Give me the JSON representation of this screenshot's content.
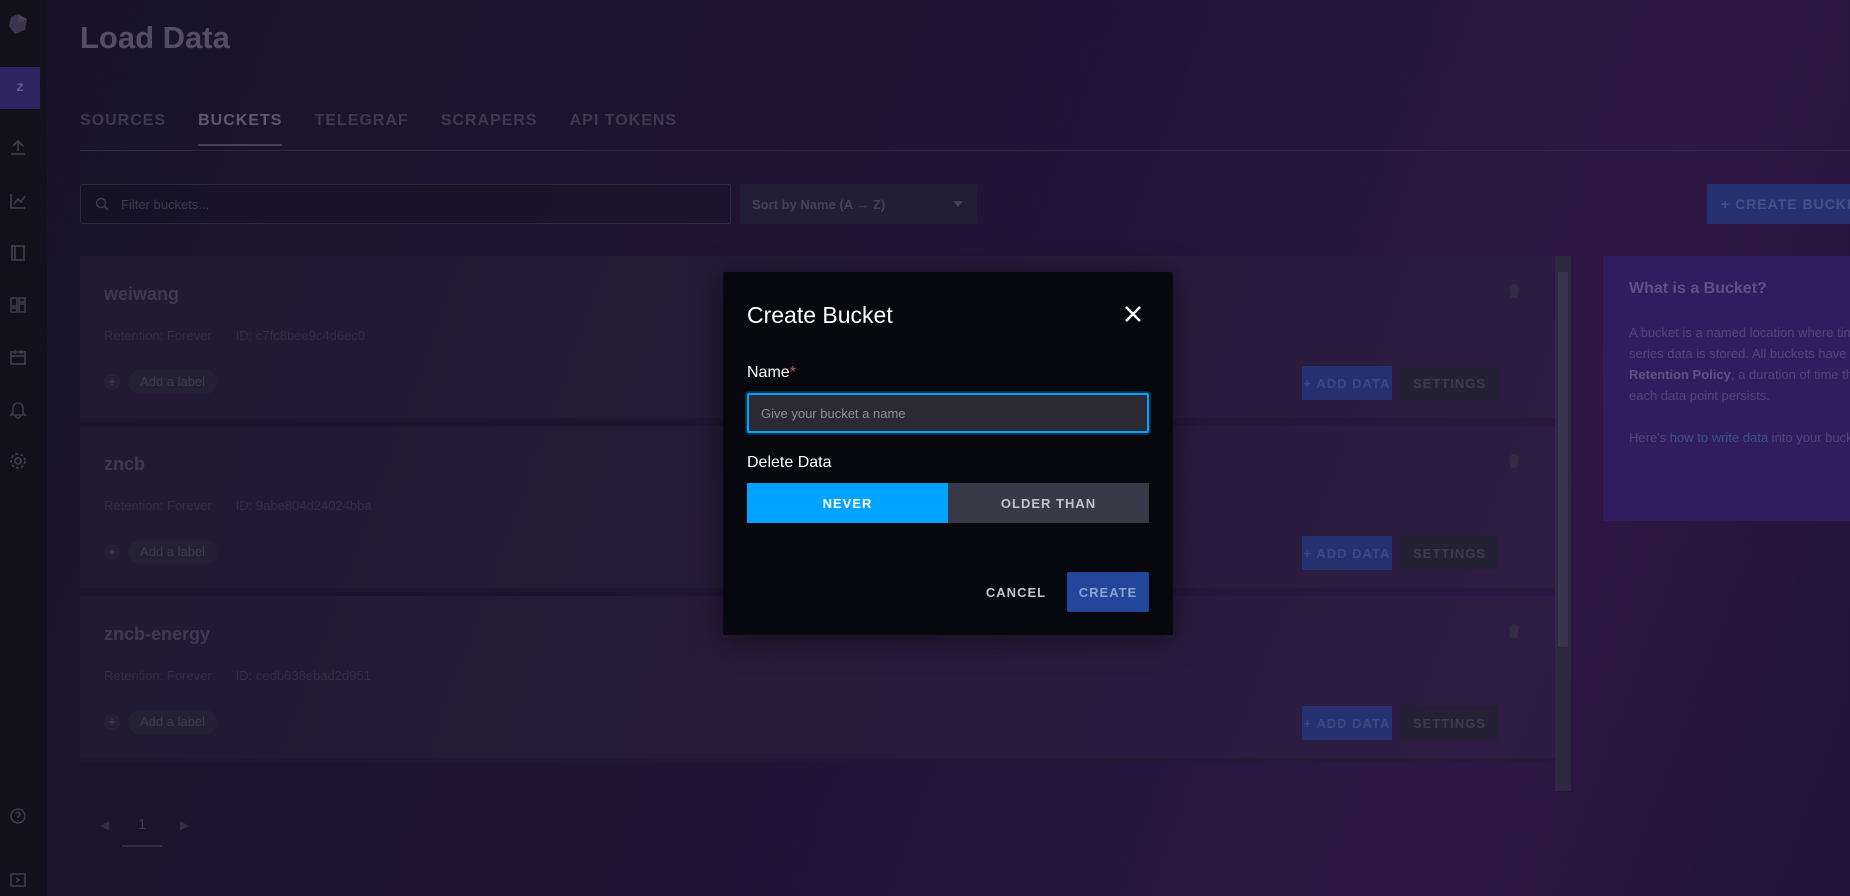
{
  "sidebar": {
    "org_initial": "Z",
    "icons": [
      "upload-icon",
      "graph-icon",
      "notebook-icon",
      "dashboards-icon",
      "calendar-icon",
      "bell-icon",
      "gear-icon",
      "help-icon",
      "expand-icon"
    ]
  },
  "page": {
    "title": "Load Data"
  },
  "tabs": [
    {
      "label": "SOURCES"
    },
    {
      "label": "BUCKETS"
    },
    {
      "label": "TELEGRAF"
    },
    {
      "label": "SCRAPERS"
    },
    {
      "label": "API TOKENS"
    }
  ],
  "toolbar": {
    "filter_placeholder": "Filter buckets...",
    "sort_label": "Sort by Name (A → Z)",
    "create_label": "+  CREATE BUCKET"
  },
  "buckets": [
    {
      "name": "weiwang",
      "retention": "Retention: Forever",
      "id": "ID: c7fc8bee9c4d6ec0",
      "add_label": "Add a label",
      "add_data": "+  ADD DATA",
      "settings": "SETTINGS"
    },
    {
      "name": "zncb",
      "retention": "Retention: Forever",
      "id": "ID: 9abe804d24024bba",
      "add_label": "Add a label",
      "add_data": "+  ADD DATA",
      "settings": "SETTINGS"
    },
    {
      "name": "zncb-energy",
      "retention": "Retention: Forever",
      "id": "ID: cedb638ebad2d951",
      "add_label": "Add a label",
      "add_data": "+  ADD DATA",
      "settings": "SETTINGS"
    }
  ],
  "pagination": {
    "current_page": "1"
  },
  "info_panel": {
    "title": "What is a Bucket?",
    "text1": "A bucket is a named location where time series data is stored. All buckets have a ",
    "bold": "Retention Policy",
    "text2": ", a duration of time that each data point persists.",
    "text3": "Here's ",
    "link": "how to write data",
    "text4": " into your bucket."
  },
  "modal": {
    "title": "Create Bucket",
    "name_label": "Name",
    "required_mark": "*",
    "name_placeholder": "Give your bucket a name",
    "name_value": "",
    "delete_label": "Delete Data",
    "never_label": "NEVER",
    "older_label": "OLDER THAN",
    "cancel_label": "CANCEL",
    "create_label": "CREATE"
  }
}
